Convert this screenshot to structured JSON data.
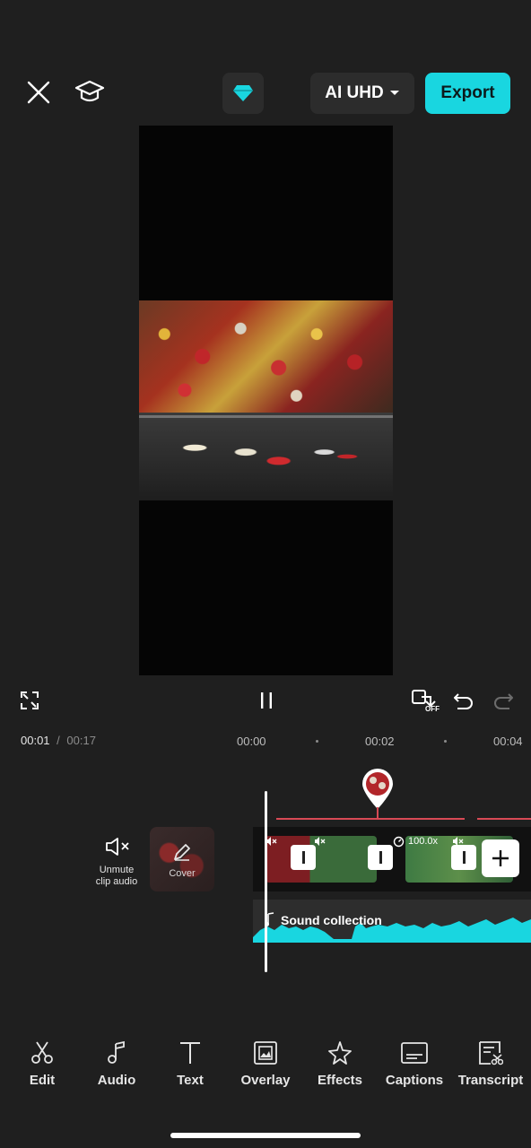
{
  "header": {
    "resolution_label": "AI UHD",
    "export_label": "Export",
    "accent_color": "#19d6e0"
  },
  "icons": {
    "close": "close-icon",
    "tutorial": "graduation-cap-icon",
    "pro": "diamond-icon",
    "fullscreen": "fullscreen-icon",
    "pause": "pause-icon",
    "keyframe": "keyframe-off-icon",
    "undo": "undo-icon",
    "redo": "redo-icon"
  },
  "playback": {
    "current_time": "00:01",
    "separator": "/",
    "total_time": "00:17",
    "keyframe_state": "OFF"
  },
  "ruler": {
    "labels": [
      "00:00",
      "00:02",
      "00:04"
    ]
  },
  "timeline": {
    "unmute_label_line1": "Unmute",
    "unmute_label_line2": "clip audio",
    "cover_label": "Cover",
    "speed_label": "100.0x",
    "sound_label": "Sound collection"
  },
  "toolbar": [
    {
      "label": "Edit",
      "icon": "scissors-icon"
    },
    {
      "label": "Audio",
      "icon": "music-note-icon"
    },
    {
      "label": "Text",
      "icon": "text-icon"
    },
    {
      "label": "Overlay",
      "icon": "overlay-icon"
    },
    {
      "label": "Effects",
      "icon": "effects-star-icon"
    },
    {
      "label": "Captions",
      "icon": "captions-icon"
    },
    {
      "label": "Transcript",
      "icon": "transcript-icon"
    }
  ]
}
